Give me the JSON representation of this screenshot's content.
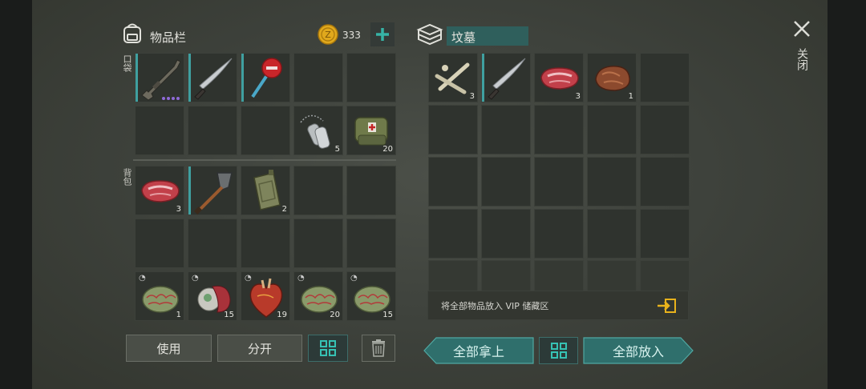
{
  "inventory": {
    "title": "物品栏",
    "coins": "333",
    "pocket_label": "口袋",
    "backpack_label": "背包",
    "pocket_counts": {
      "dogtag": "5",
      "medbag": "20"
    },
    "backpack_counts": {
      "steak": "3",
      "jerrycan": "2",
      "brain1": "1",
      "heart_flesh": "15",
      "heart": "19",
      "brain2": "20",
      "brain3": "15"
    }
  },
  "container": {
    "title": "坟墓",
    "counts": {
      "bones": "3",
      "steak": "3",
      "meat": "1"
    },
    "vip_text": "将全部物品放入 VIP 储藏区"
  },
  "buttons": {
    "use": "使用",
    "split": "分开",
    "take_all": "全部拿上",
    "put_all": "全部放入"
  },
  "close_label": "关闭",
  "colors": {
    "accent": "#3fa0a0",
    "teal_button": "#2f6f6c",
    "coin": "#e0a81c"
  }
}
